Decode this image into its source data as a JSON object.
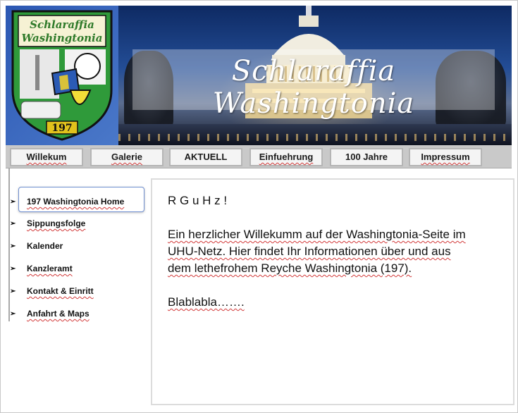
{
  "header": {
    "title": "Schlaraffia Washingtonia",
    "crest": {
      "line1": "Schlaraffia",
      "line2": "Washingtonia",
      "number": "197"
    }
  },
  "nav": {
    "items": [
      {
        "label": "Willekum"
      },
      {
        "label": "Galerie"
      },
      {
        "label": "AKTUELL"
      },
      {
        "label": "Einfuehrung"
      },
      {
        "label": "100 Jahre"
      },
      {
        "label": "Impressum"
      }
    ]
  },
  "sidebar": {
    "items": [
      {
        "label": "197 Washingtonia Home",
        "active": true
      },
      {
        "label": "Sippungsfolge"
      },
      {
        "label": "Kalender"
      },
      {
        "label": "Kanzleramt"
      },
      {
        "label": "Kontakt & Einritt"
      },
      {
        "label": "Anfahrt & Maps"
      }
    ]
  },
  "content": {
    "greeting": "R G u H z !",
    "paragraph_line1": "Ein herzlicher Willekumm auf der Washingtonia-Seite im",
    "paragraph_line2": "UHU-Netz. Hier findet Ihr Informationen über und aus",
    "paragraph_line3": "dem lethefrohem Reyche Washingtonia (197).",
    "footer": "Blablabla……."
  },
  "colors": {
    "crest_green": "#2f9a3a",
    "crest_gold": "#e2c21c",
    "banner_blue": "#234d96",
    "nav_bg": "#c9c9c9"
  }
}
